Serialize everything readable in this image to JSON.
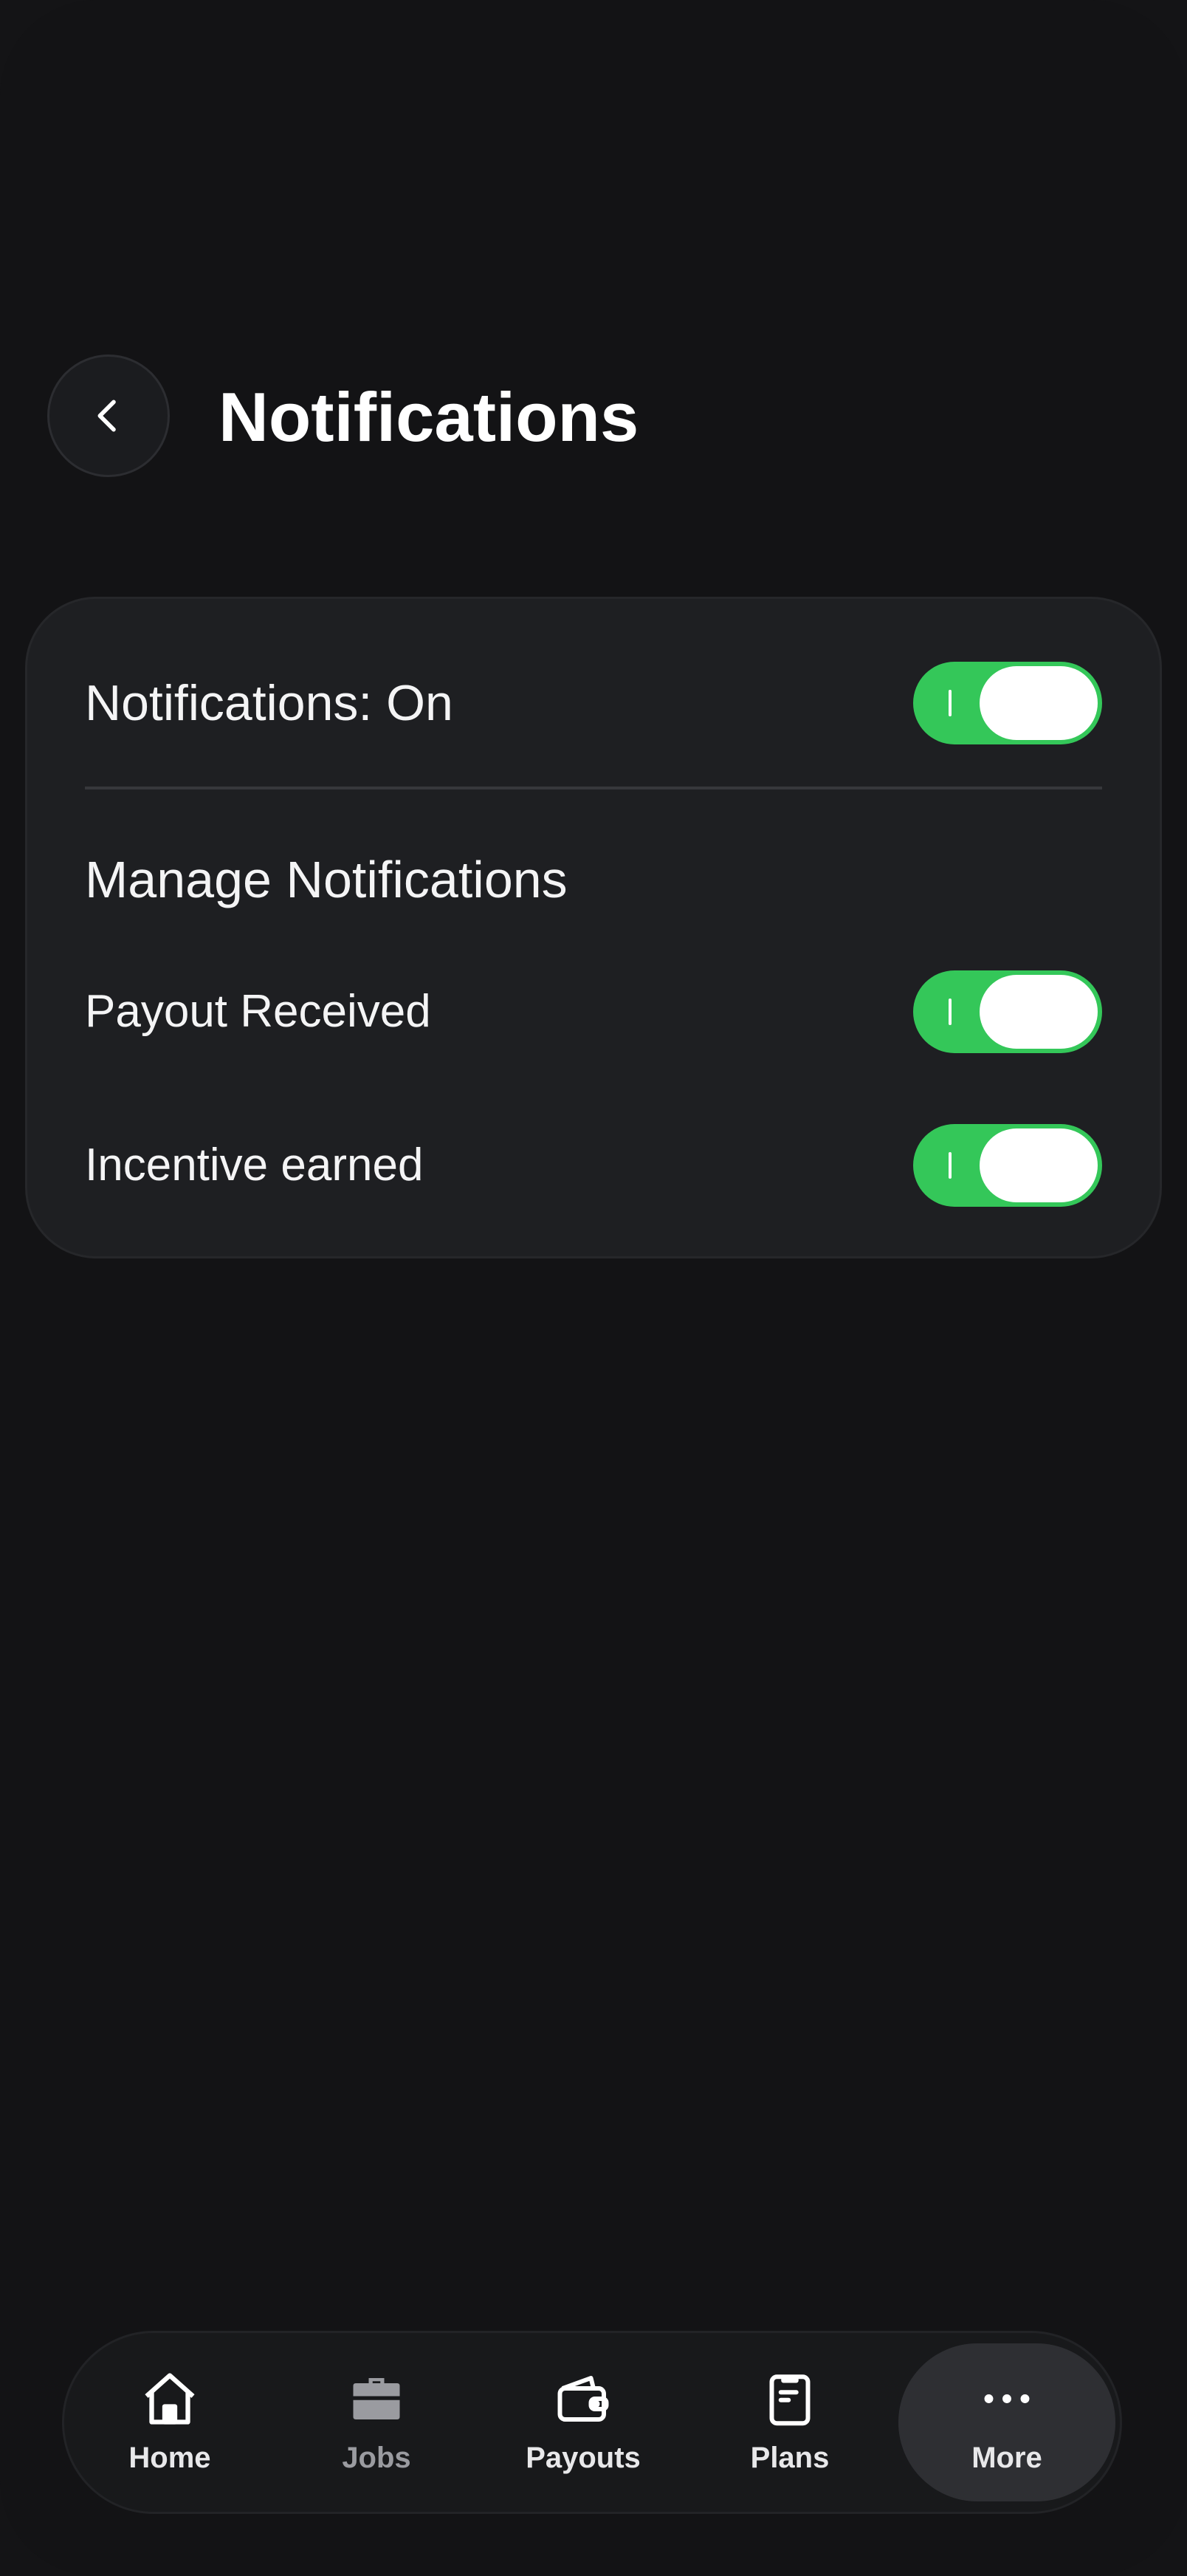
{
  "header": {
    "title": "Notifications"
  },
  "card": {
    "master": {
      "label": "Notifications: On",
      "enabled": true
    },
    "section_heading": "Manage Notifications",
    "items": [
      {
        "label": "Payout Received",
        "enabled": true
      },
      {
        "label": "Incentive earned",
        "enabled": true
      }
    ]
  },
  "tabbar": {
    "tabs": [
      {
        "label": "Home",
        "icon": "home-icon"
      },
      {
        "label": "Jobs",
        "icon": "briefcase-icon"
      },
      {
        "label": "Payouts",
        "icon": "wallet-icon"
      },
      {
        "label": "Plans",
        "icon": "clipboard-icon"
      },
      {
        "label": "More",
        "icon": "more-dots-icon",
        "active": true
      }
    ]
  },
  "colors": {
    "background": "#131315",
    "card": "#1e1f22",
    "toggle_on": "#34c759",
    "active_tab": "#2e2f33"
  }
}
